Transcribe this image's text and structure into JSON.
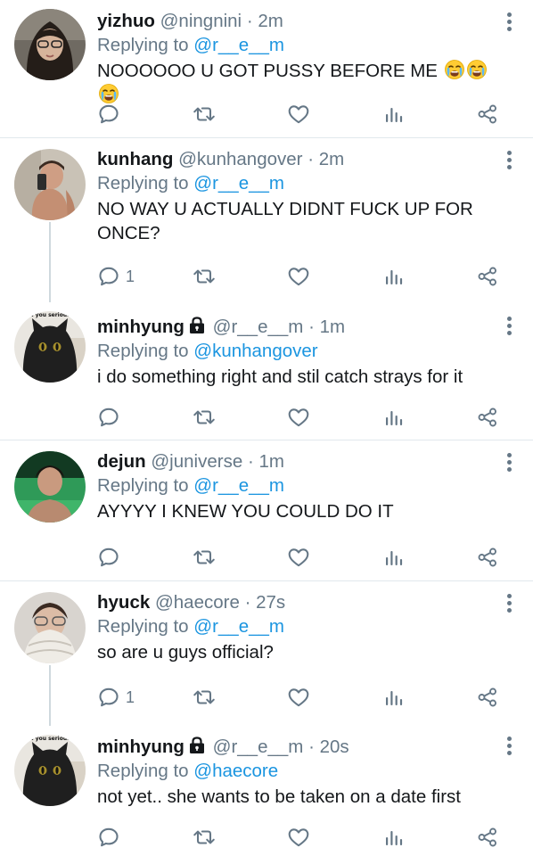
{
  "tweets": [
    {
      "name": "yizhuo",
      "handle": "@ningnini",
      "dot": "·",
      "time": "2m",
      "locked": false,
      "replying_prefix": "Replying to",
      "replying_to": "@r__e__m",
      "text": "NOOOOOO U GOT PUSSY BEFORE ME",
      "emoji_icons": [
        "crying-face-icon",
        "crying-face-icon",
        "crying-face-icon"
      ],
      "reply_count": ""
    },
    {
      "name": "kunhang",
      "handle": "@kunhangover",
      "dot": "·",
      "time": "2m",
      "locked": false,
      "replying_prefix": "Replying to",
      "replying_to": "@r__e__m",
      "text": "NO WAY U ACTUALLY DIDNT FUCK UP FOR ONCE?",
      "reply_count": "1"
    },
    {
      "name": "minhyung",
      "handle": "@r__e__m",
      "dot": "·",
      "time": "1m",
      "locked": true,
      "replying_prefix": "Replying to",
      "replying_to": "@kunhangover",
      "text": "i do something right and stil catch strays for it",
      "avatar_caption": "u you serious",
      "reply_count": ""
    },
    {
      "name": "dejun",
      "handle": "@juniverse",
      "dot": "·",
      "time": "1m",
      "locked": false,
      "replying_prefix": "Replying to",
      "replying_to": "@r__e__m",
      "text": "AYYYY I KNEW YOU COULD DO IT",
      "reply_count": ""
    },
    {
      "name": "hyuck",
      "handle": "@haecore",
      "dot": "·",
      "time": "27s",
      "locked": false,
      "replying_prefix": "Replying to",
      "replying_to": "@r__e__m",
      "text": "so are u guys official?",
      "reply_count": "1"
    },
    {
      "name": "minhyung",
      "handle": "@r__e__m",
      "dot": "·",
      "time": "20s",
      "locked": true,
      "replying_prefix": "Replying to",
      "replying_to": "@haecore",
      "text": "not yet.. she wants to be taken on a date first",
      "avatar_caption": "u you serious",
      "reply_count": ""
    }
  ],
  "colors": {
    "text": "#14171a",
    "secondary": "#657786",
    "link": "#1b95e0",
    "divider": "#e1e8ed"
  },
  "icons": [
    "reply-icon",
    "retweet-icon",
    "like-icon",
    "analytics-icon",
    "share-icon",
    "more-options-icon",
    "lock-icon"
  ]
}
